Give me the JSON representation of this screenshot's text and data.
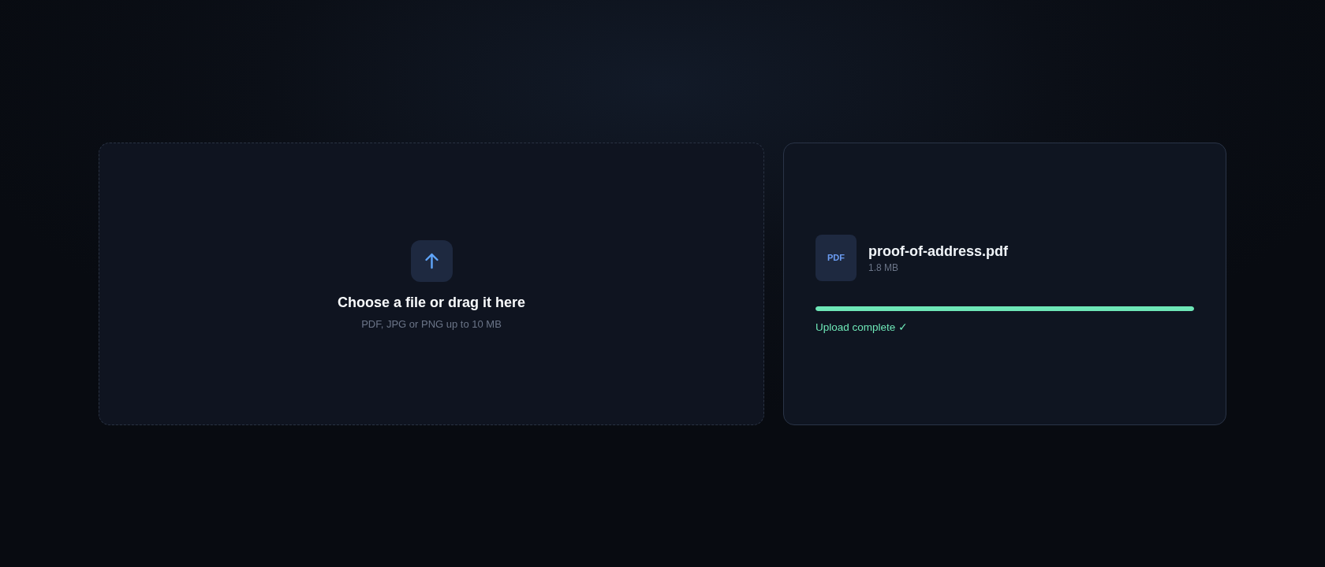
{
  "upload_zone": {
    "title": "Choose a file or drag it here",
    "hint": "PDF, JPG or PNG up to 10 MB"
  },
  "file": {
    "type_label": "PDF",
    "name": "proof-of-address.pdf",
    "size": "1.8 MB",
    "progress": {
      "level": 1
    },
    "status": "Upload complete ✓"
  }
}
